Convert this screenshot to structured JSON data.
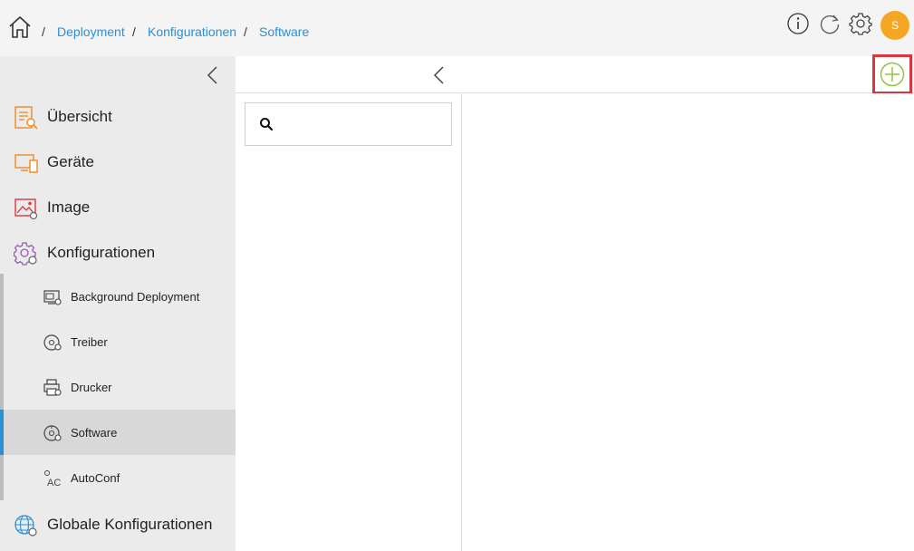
{
  "header": {
    "breadcrumbs": [
      {
        "label": "Deployment"
      },
      {
        "label": "Konfigurationen"
      },
      {
        "label": "Software"
      }
    ],
    "separator": "/",
    "icons": [
      "home-icon",
      "info-icon",
      "refresh-icon",
      "settings-gear-icon"
    ],
    "avatar": {
      "initial": "S",
      "color": "#f5a623"
    }
  },
  "sidebar": {
    "items": [
      {
        "label": "Übersicht",
        "icon": "overview-icon"
      },
      {
        "label": "Geräte",
        "icon": "devices-icon"
      },
      {
        "label": "Image",
        "icon": "image-icon"
      },
      {
        "label": "Konfigurationen",
        "icon": "configurations-icon"
      }
    ],
    "sub_items": [
      {
        "label": "Background Deployment",
        "icon": "background-deployment-icon"
      },
      {
        "label": "Treiber",
        "icon": "driver-icon"
      },
      {
        "label": "Drucker",
        "icon": "printer-icon"
      },
      {
        "label": "Software",
        "icon": "software-icon",
        "active": true
      },
      {
        "label": "AutoConf",
        "icon": "autoconf-icon"
      }
    ],
    "bottom_item": {
      "label": "Globale Konfigurationen",
      "icon": "global-config-icon"
    }
  },
  "search": {
    "placeholder": "",
    "value": ""
  },
  "colors": {
    "accent_blue": "#2a8fd4",
    "icon_orange": "#f08a24",
    "add_green": "#8cc63f",
    "highlight_red": "#d9363e",
    "avatar_orange": "#f5a623"
  }
}
